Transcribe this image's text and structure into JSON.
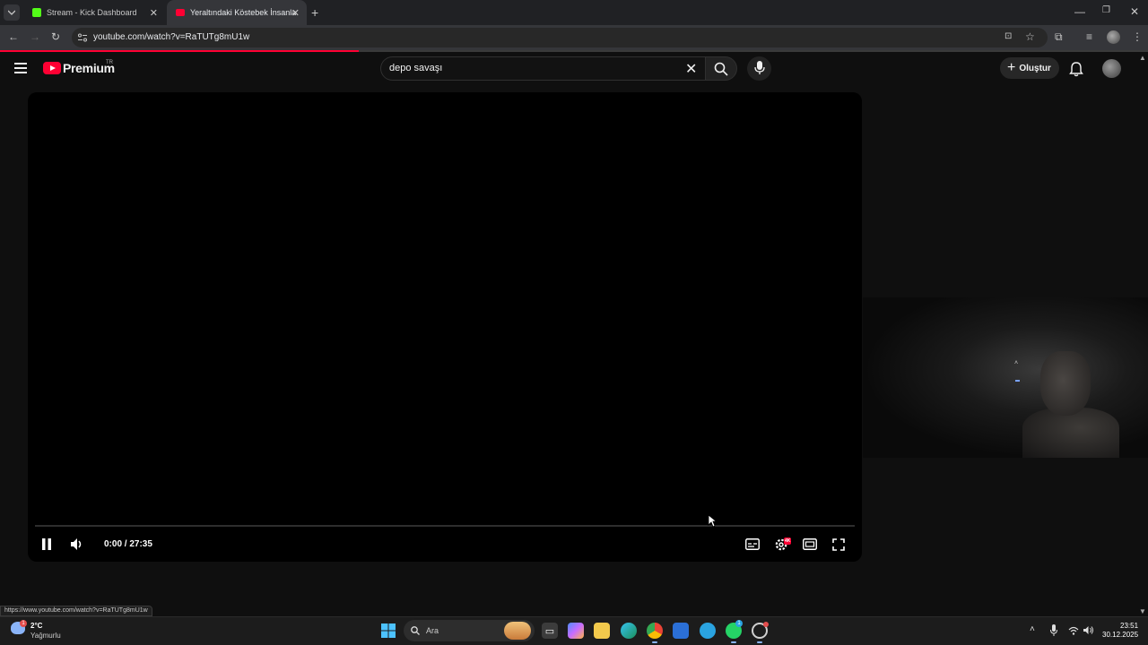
{
  "browser": {
    "tabs": [
      {
        "label": "Stream - Kick Dashboard",
        "favicon_color": "#53fc18"
      },
      {
        "label": "Yeraltındaki Köstebek İnsanlara",
        "favicon_color": "#ff0033"
      }
    ],
    "url": "youtube.com/watch?v=RaTUTg8mU1w",
    "status_url": "https://www.youtube.com/watch?v=RaTUTg8mU1w"
  },
  "youtube": {
    "brand": "Premium",
    "country": "TR",
    "search_query": "depo savaşı",
    "create_label": "Oluştur",
    "accent_color": "#ff0033"
  },
  "player": {
    "timecode": "0:00 / 27:35",
    "progress_fraction": 0,
    "settings_badge": "4K"
  },
  "taskbar": {
    "weather_temp": "2°C",
    "weather_desc": "Yağmurlu",
    "weather_badge": "1",
    "search_label": "Ara",
    "clock_time": "23:51",
    "clock_date": "30.12.2025",
    "whatsapp_badge": "1"
  }
}
